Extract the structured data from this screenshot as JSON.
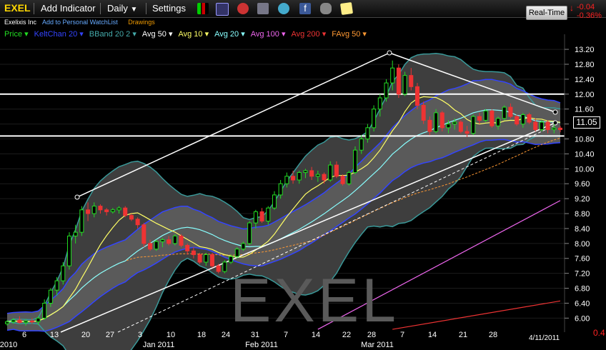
{
  "toolbar": {
    "symbol": "EXEL",
    "add_indicator": "Add Indicator",
    "period": "Daily",
    "settings": "Settings",
    "realtime": "Real-Time",
    "change": "-0.04",
    "change_pct": "-0.36%"
  },
  "subheader": {
    "company": "Exelixis Inc",
    "watchlist": "Add to Personal WatchList",
    "drawings": "Drawings"
  },
  "legend": [
    {
      "label": "Price",
      "color": "#22dd22"
    },
    {
      "label": "KeltChan 20",
      "color": "#3344ff"
    },
    {
      "label": "BBand 20 2",
      "color": "#44aaaa"
    },
    {
      "label": "Avg 50",
      "color": "#ffffff"
    },
    {
      "label": "Avg 10",
      "color": "#ffff66"
    },
    {
      "label": "Avg 20",
      "color": "#88ffff"
    },
    {
      "label": "Avg 100",
      "color": "#ee66ee"
    },
    {
      "label": "Avg 200",
      "color": "#ee3333"
    },
    {
      "label": "FAvg 50",
      "color": "#ff9933"
    }
  ],
  "watermark": "EXEL",
  "last_price": "11.05",
  "date_label": "4/11/2011",
  "right_edge_label": "0.4",
  "chart_data": {
    "type": "candlestick",
    "y_ticks": [
      6.0,
      6.4,
      6.8,
      7.2,
      7.6,
      8.0,
      8.4,
      8.8,
      9.2,
      9.6,
      10.0,
      10.4,
      10.8,
      11.2,
      11.6,
      12.0,
      12.4,
      12.8,
      13.2
    ],
    "y_tick_labels": [
      "6.00",
      "6.40",
      "6.80",
      "7.20",
      "7.60",
      "8.00",
      "8.40",
      "8.80",
      "9.20",
      "9.60",
      "10.00",
      "10.40",
      "10.80",
      "11.20",
      "11.60",
      "12.00",
      "12.40",
      "12.80",
      "13.20"
    ],
    "ylim": [
      5.72,
      13.45
    ],
    "x_day_labels": [
      "6",
      "13",
      "20",
      "27",
      "3",
      "10",
      "18",
      "24",
      "31",
      "7",
      "14",
      "22",
      "28",
      "7",
      "14",
      "21",
      "28"
    ],
    "x_month_labels": [
      "2010",
      "Jan 2011",
      "Feb 2011",
      "Mar 2011"
    ],
    "horizontal_lines": [
      12.0,
      10.88
    ],
    "candles": [
      [
        5.85,
        5.95,
        5.8,
        5.9
      ],
      [
        5.9,
        6.0,
        5.85,
        5.95
      ],
      [
        5.95,
        6.05,
        5.85,
        5.88
      ],
      [
        5.88,
        5.98,
        5.8,
        5.92
      ],
      [
        5.92,
        6.0,
        5.85,
        5.9
      ],
      [
        5.9,
        6.05,
        5.82,
        6.0
      ],
      [
        6.0,
        6.5,
        5.95,
        6.4
      ],
      [
        6.4,
        6.8,
        6.3,
        6.75
      ],
      [
        6.75,
        7.1,
        6.6,
        7.0
      ],
      [
        7.0,
        7.5,
        6.9,
        7.4
      ],
      [
        7.4,
        8.3,
        7.3,
        8.2
      ],
      [
        8.2,
        8.5,
        8.0,
        8.3
      ],
      [
        8.3,
        9.0,
        8.2,
        8.9
      ],
      [
        8.9,
        9.1,
        8.6,
        8.8
      ],
      [
        8.8,
        9.1,
        8.7,
        9.0
      ],
      [
        9.0,
        9.05,
        8.8,
        8.9
      ],
      [
        8.9,
        8.95,
        8.75,
        8.85
      ],
      [
        8.85,
        8.95,
        8.8,
        8.9
      ],
      [
        8.9,
        9.0,
        8.8,
        8.95
      ],
      [
        8.95,
        9.0,
        8.7,
        8.75
      ],
      [
        8.75,
        8.8,
        8.6,
        8.65
      ],
      [
        8.65,
        8.7,
        8.4,
        8.5
      ],
      [
        8.5,
        8.55,
        7.9,
        8.0
      ],
      [
        8.0,
        8.1,
        7.8,
        7.85
      ],
      [
        7.85,
        8.1,
        7.8,
        8.05
      ],
      [
        8.05,
        8.15,
        7.9,
        8.1
      ],
      [
        8.1,
        8.2,
        7.95,
        8.0
      ],
      [
        8.0,
        8.25,
        7.95,
        8.2
      ],
      [
        8.2,
        8.25,
        7.9,
        7.95
      ],
      [
        7.95,
        8.0,
        7.7,
        7.8
      ],
      [
        7.8,
        7.9,
        7.6,
        7.7
      ],
      [
        7.7,
        7.75,
        7.45,
        7.5
      ],
      [
        7.5,
        7.75,
        7.4,
        7.7
      ],
      [
        7.7,
        7.75,
        7.35,
        7.4
      ],
      [
        7.4,
        7.45,
        7.2,
        7.25
      ],
      [
        7.25,
        7.55,
        7.2,
        7.5
      ],
      [
        7.5,
        7.7,
        7.45,
        7.65
      ],
      [
        7.65,
        7.9,
        7.6,
        7.85
      ],
      [
        7.85,
        8.05,
        7.8,
        8.0
      ],
      [
        8.0,
        8.6,
        7.95,
        8.55
      ],
      [
        8.55,
        8.9,
        8.4,
        8.85
      ],
      [
        8.85,
        8.95,
        8.55,
        8.6
      ],
      [
        8.6,
        9.0,
        8.5,
        8.95
      ],
      [
        8.95,
        9.4,
        8.9,
        9.3
      ],
      [
        9.3,
        9.7,
        9.2,
        9.6
      ],
      [
        9.6,
        9.9,
        9.5,
        9.8
      ],
      [
        9.8,
        9.95,
        9.6,
        9.7
      ],
      [
        9.7,
        9.95,
        9.6,
        9.9
      ],
      [
        9.9,
        10.0,
        9.75,
        9.95
      ],
      [
        9.95,
        10.05,
        9.7,
        9.8
      ],
      [
        9.8,
        9.95,
        9.65,
        9.85
      ],
      [
        9.85,
        9.9,
        9.6,
        9.7
      ],
      [
        9.7,
        10.2,
        9.65,
        10.1
      ],
      [
        10.1,
        10.2,
        9.75,
        9.8
      ],
      [
        9.8,
        9.85,
        9.55,
        9.6
      ],
      [
        9.6,
        9.95,
        9.55,
        9.9
      ],
      [
        9.9,
        10.6,
        9.85,
        10.5
      ],
      [
        10.5,
        10.9,
        10.4,
        10.8
      ],
      [
        10.8,
        11.2,
        10.7,
        11.1
      ],
      [
        11.1,
        11.7,
        11.0,
        11.6
      ],
      [
        11.6,
        12.0,
        11.4,
        11.9
      ],
      [
        11.9,
        12.4,
        11.8,
        12.3
      ],
      [
        12.3,
        12.9,
        12.1,
        12.7
      ],
      [
        12.7,
        12.8,
        11.9,
        12.0
      ],
      [
        12.0,
        12.6,
        11.95,
        12.5
      ],
      [
        12.5,
        12.7,
        12.1,
        12.2
      ],
      [
        12.2,
        12.3,
        11.6,
        11.7
      ],
      [
        11.7,
        11.8,
        11.2,
        11.3
      ],
      [
        11.3,
        11.4,
        10.9,
        11.0
      ],
      [
        11.0,
        11.6,
        10.95,
        11.5
      ],
      [
        11.5,
        11.55,
        11.0,
        11.1
      ],
      [
        11.1,
        11.3,
        10.95,
        11.2
      ],
      [
        11.2,
        11.35,
        11.05,
        11.25
      ],
      [
        11.25,
        11.3,
        10.95,
        11.0
      ],
      [
        11.0,
        11.15,
        10.85,
        10.95
      ],
      [
        10.95,
        11.45,
        10.9,
        11.4
      ],
      [
        11.4,
        11.5,
        11.2,
        11.3
      ],
      [
        11.3,
        11.6,
        11.25,
        11.55
      ],
      [
        11.55,
        11.6,
        11.1,
        11.15
      ],
      [
        11.15,
        11.4,
        11.05,
        11.35
      ],
      [
        11.35,
        11.7,
        11.3,
        11.65
      ],
      [
        11.65,
        11.75,
        11.35,
        11.4
      ],
      [
        11.4,
        11.45,
        11.15,
        11.2
      ],
      [
        11.2,
        11.5,
        11.1,
        11.45
      ],
      [
        11.45,
        11.5,
        11.2,
        11.25
      ],
      [
        11.25,
        11.35,
        11.0,
        11.05
      ],
      [
        11.05,
        11.3,
        11.0,
        11.25
      ],
      [
        11.25,
        11.3,
        10.95,
        11.05
      ],
      [
        11.05,
        11.2,
        10.95,
        11.09
      ],
      [
        11.09,
        11.15,
        10.98,
        11.05
      ]
    ]
  }
}
